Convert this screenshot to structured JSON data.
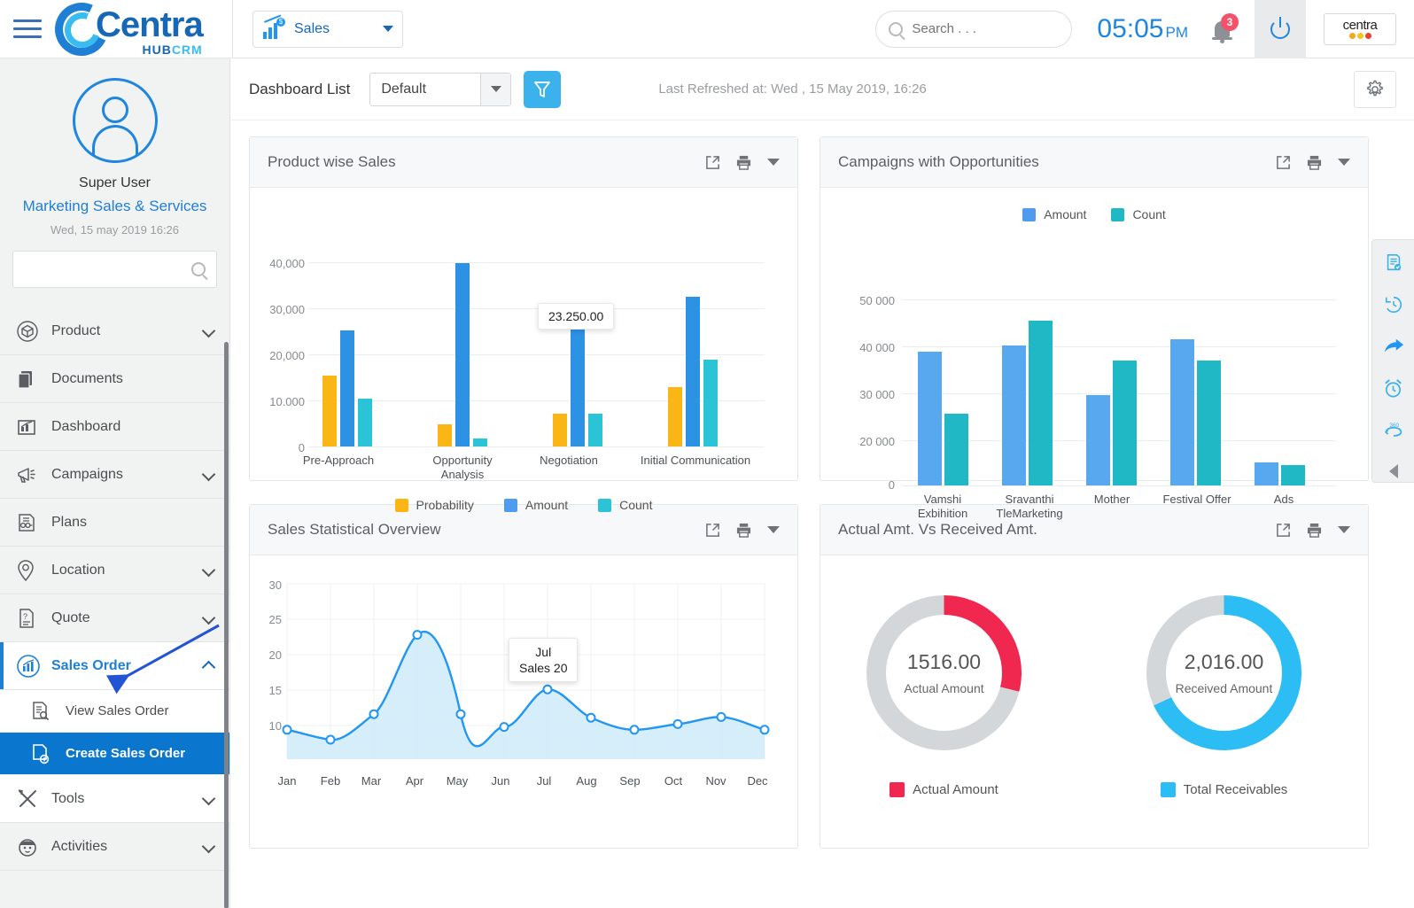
{
  "topbar": {
    "brand_main": "Centra",
    "brand_hub": "HUB",
    "brand_crm": "CRM",
    "module_label": "Sales",
    "search_placeholder": "Search . . .",
    "time": "05:05",
    "ampm": "PM",
    "notification_count": "3",
    "centra_badge_text": "centra"
  },
  "sidebar": {
    "user_name": "Super User",
    "user_org": "Marketing Sales & Services",
    "user_date": "Wed, 15 may 2019 16:26",
    "search_placeholder": "",
    "items": [
      {
        "label": "Product",
        "icon": "box-icon",
        "expandable": true
      },
      {
        "label": "Documents",
        "icon": "documents-icon",
        "expandable": false
      },
      {
        "label": "Dashboard",
        "icon": "dashboard-icon",
        "expandable": false
      },
      {
        "label": "Campaigns",
        "icon": "megaphone-icon",
        "expandable": true
      },
      {
        "label": "Plans",
        "icon": "plans-icon",
        "expandable": false
      },
      {
        "label": "Location",
        "icon": "map-pin-icon",
        "expandable": true
      },
      {
        "label": "Quote",
        "icon": "quote-icon",
        "expandable": true
      },
      {
        "label": "Sales Order",
        "icon": "sales-order-icon",
        "expandable": true,
        "active": true
      },
      {
        "label": "Tools",
        "icon": "tools-icon",
        "expandable": true
      },
      {
        "label": "Activities",
        "icon": "activities-icon",
        "expandable": true
      }
    ],
    "sub_items": [
      {
        "label": "View Sales Order",
        "icon": "view-document-icon",
        "selected": false
      },
      {
        "label": "Create Sales Order",
        "icon": "add-document-icon",
        "selected": true
      }
    ]
  },
  "toolbar": {
    "dashboard_list_label": "Dashboard List",
    "dashboard_selected": "Default",
    "filter_icon": "funnel-icon",
    "last_refreshed": "Last Refreshed at: Wed , 15 May 2019, 16:26",
    "settings_icon": "gear-icon"
  },
  "cards": [
    {
      "title": "Product wise Sales"
    },
    {
      "title": "Campaigns with Opportunities"
    },
    {
      "title": "Sales Statistical Overview"
    },
    {
      "title": "Actual Amt. Vs Received Amt."
    }
  ],
  "card_tools": {
    "expand": "expand-icon",
    "print": "print-icon",
    "menu": "caret-down-icon"
  },
  "rail_icons": [
    "task-list-icon",
    "history-icon",
    "forward-icon",
    "alarm-clock-icon",
    "refresh-360-icon",
    "collapse-left-icon"
  ],
  "colors": {
    "probability": "#f9b615",
    "amount": "#2e92e4",
    "count": "#2ac4d6",
    "amount_light": "#58a8ef",
    "count_teal": "#1fb8c4",
    "actual": "#f0284f",
    "receivables": "#2cbdf5",
    "track": "#d4d7d9",
    "line": "#2196f3",
    "accent": "#1f7fd4"
  },
  "chart_data": [
    {
      "type": "bar",
      "title": "Product wise Sales",
      "categories": [
        "Pre-Approach",
        "Opportunity Analysis",
        "Negotiation",
        "Initial Communication"
      ],
      "series": [
        {
          "name": "Probability",
          "values": [
            15750,
            4900,
            7200,
            13100
          ]
        },
        {
          "name": "Amount",
          "values": [
            25700,
            40600,
            27900,
            33200
          ]
        },
        {
          "name": "Count",
          "values": [
            10500,
            1700,
            7200,
            19200
          ]
        }
      ],
      "ylabel": "",
      "xlabel": "",
      "ylim": [
        0,
        40000
      ],
      "yticks": [
        "0",
        "10.000",
        "20,000",
        "30,000",
        "40,000"
      ],
      "grid": true,
      "legend_position": "bottom",
      "annotation": {
        "text": "23.250.00",
        "series": "Amount",
        "category": "Negotiation"
      }
    },
    {
      "type": "bar",
      "title": "Campaigns with Opportunities",
      "categories": [
        "Vamshi Exbihition",
        "Sravanthi TleMarketing",
        "Mother",
        "Festival Offer",
        "Ads"
      ],
      "series": [
        {
          "name": "Amount",
          "values": [
            36000,
            37700,
            24200,
            39300,
            6100
          ]
        },
        {
          "name": "Count",
          "values": [
            19300,
            44300,
            33600,
            33600,
            5500
          ]
        }
      ],
      "ylim": [
        0,
        50000
      ],
      "yticks": [
        "0",
        "20 000",
        "30 000",
        "40 000",
        "50 000"
      ],
      "grid": true,
      "legend_position": "top-right"
    },
    {
      "type": "area",
      "title": "Sales Statistical Overview",
      "categories": [
        "Jan",
        "Feb",
        "Mar",
        "Apr",
        "May",
        "Jun",
        "Jul",
        "Aug",
        "Sep",
        "Oct",
        "Nov",
        "Dec"
      ],
      "series": [
        {
          "name": "Sales",
          "values": [
            9.4,
            8.0,
            11.6,
            22.8,
            11.6,
            9.8,
            15.1,
            11.1,
            9.4,
            10.2,
            11.2,
            9.4
          ]
        }
      ],
      "ylim": [
        5,
        30
      ],
      "yticks": [
        "10",
        "15",
        "20",
        "25",
        "30"
      ],
      "grid": true,
      "annotation": {
        "title": "Jul",
        "text": "Sales 20",
        "category": "Jul"
      }
    },
    {
      "type": "pie",
      "title": "Actual Amt. Vs Received Amt.",
      "donuts": [
        {
          "value": "1516.00",
          "caption": "Actual Amount",
          "legend": "Actual Amount",
          "percent": 29,
          "color": "#f0284f"
        },
        {
          "value": "2,016.00",
          "caption": "Received Amount",
          "legend": "Total Receivables",
          "percent": 68,
          "color": "#2cbdf5"
        }
      ]
    }
  ]
}
